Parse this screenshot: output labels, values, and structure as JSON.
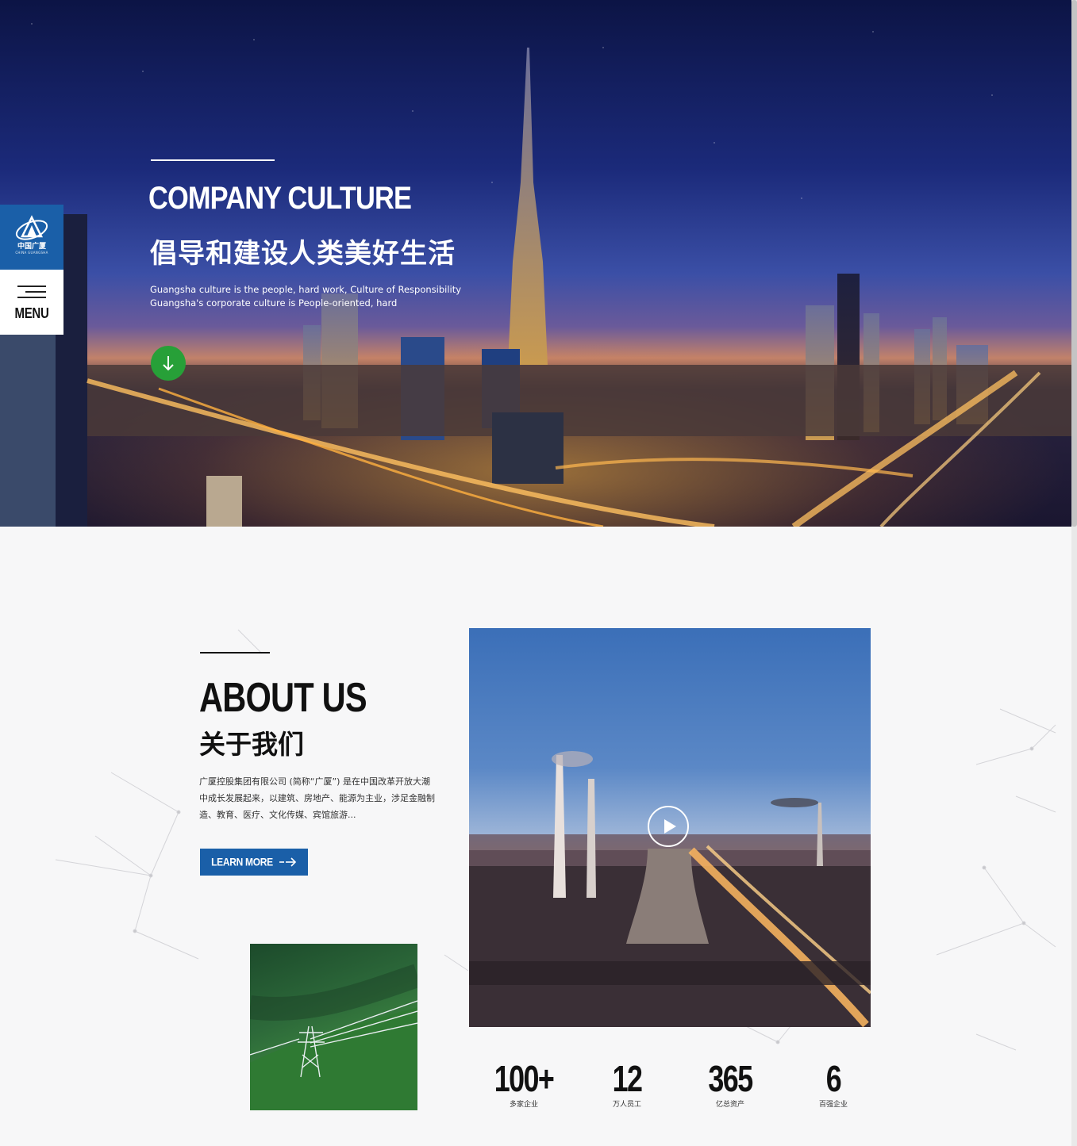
{
  "hero": {
    "title": "COMPANY CULTURE",
    "subtitle_cn": "倡导和建设人类美好生活",
    "desc_line1": "Guangsha culture is the people, hard work, Culture of Responsibility",
    "desc_line2": "Guangsha's corporate culture is People-oriented, hard"
  },
  "sidebar": {
    "logo_cn": "中国广厦",
    "logo_en": "CHINA GUANGSHA",
    "menu_label": "MENU"
  },
  "about": {
    "title": "ABOUT US",
    "title_cn": "关于我们",
    "text": "广厦控股集团有限公司 (简称“广厦”) 是在中国改革开放大潮中成长发展起来，以建筑、房地产、能源为主业，涉足金融制造、教育、医疗、文化传媒、宾馆旅游...",
    "button_label": "LEARN MORE"
  },
  "stats": [
    {
      "value": "100+",
      "label": "多家企业"
    },
    {
      "value": "12",
      "label": "万人员工"
    },
    {
      "value": "365",
      "label": "亿总资产"
    },
    {
      "value": "6",
      "label": "百强企业"
    }
  ],
  "colors": {
    "brand_blue": "#1a5fa8",
    "accent_green": "#27a038"
  },
  "icons": [
    "logo-icon",
    "hamburger-icon",
    "arrow-down-icon",
    "arrow-right-icon",
    "play-icon"
  ]
}
